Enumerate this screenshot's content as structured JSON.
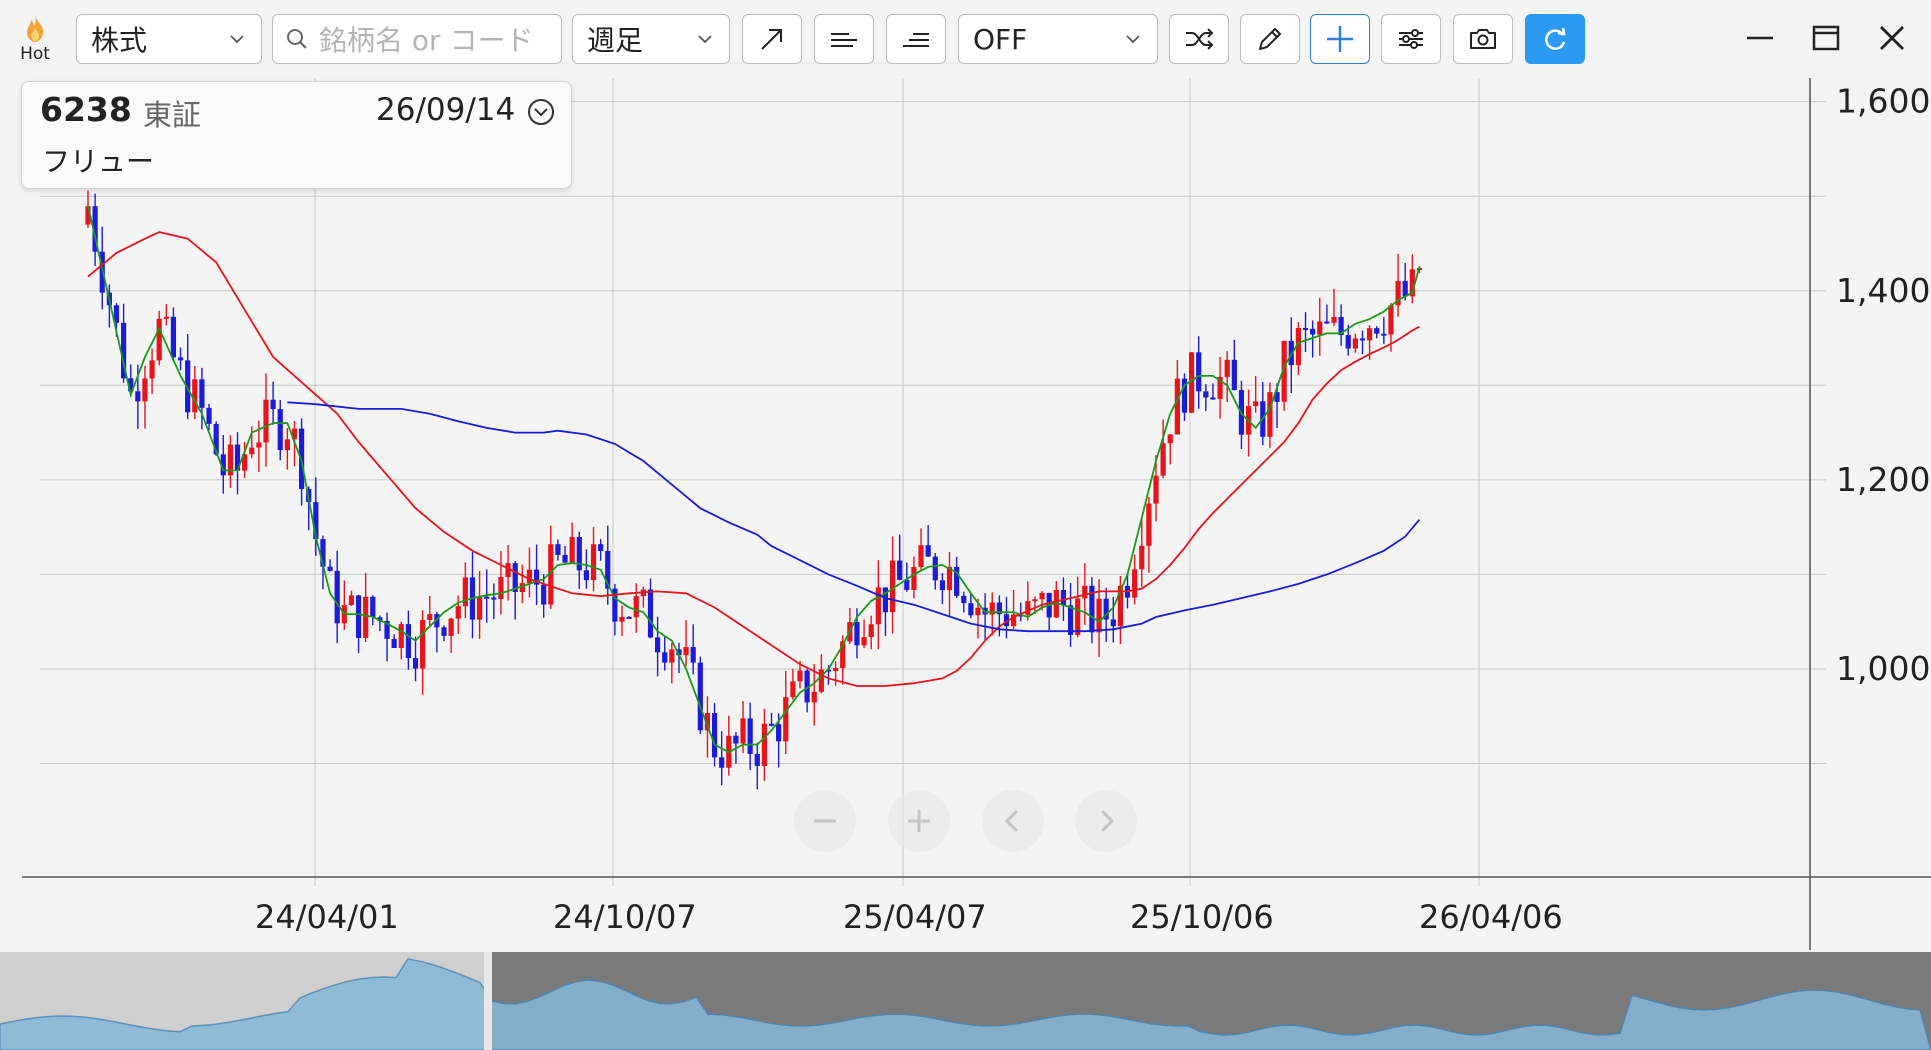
{
  "toolbar": {
    "hot_label": "Hot",
    "market_select": "株式",
    "search_placeholder": "銘柄名 or コード",
    "period_select": "週足",
    "indicator_select": "OFF",
    "icons": [
      "trendline-icon",
      "horizontal-line-icon",
      "horizontal-lines-icon",
      "shuffle-icon",
      "pencil-icon",
      "crosshair-icon",
      "settings-sliders-icon",
      "camera-icon",
      "refresh-icon"
    ]
  },
  "window": {
    "icons": [
      "minimize-icon",
      "maximize-icon",
      "close-icon"
    ]
  },
  "info": {
    "code": "6238",
    "exchange": "東証",
    "date": "26/09/14",
    "name": "フリュー"
  },
  "colors": {
    "up": "#e8141c",
    "down": "#1b1bd8",
    "ma_short": "#1a9a1a",
    "ma_mid": "#e8141c",
    "ma_long": "#1b1bd8",
    "accent": "#2c9af0"
  },
  "chart_data": {
    "type": "candlestick",
    "period": "weekly",
    "y_axis": {
      "ticks": [
        1000,
        1200,
        1400,
        1600
      ],
      "range": [
        780,
        1625
      ],
      "position": "right",
      "grid": true
    },
    "x_axis": {
      "tick_labels": [
        "24/04/01",
        "24/10/07",
        "25/04/07",
        "25/10/06",
        "26/04/06"
      ],
      "grid": true
    },
    "approx_price_range_low_high": [
      810,
      1505
    ],
    "last_close_estimate": 1480,
    "moving_averages": [
      {
        "color": "green",
        "points": [
          [
            0,
            1490
          ],
          [
            3,
            1390
          ],
          [
            6,
            1290
          ],
          [
            8,
            1330
          ],
          [
            10,
            1360
          ],
          [
            13,
            1310
          ],
          [
            16,
            1270
          ],
          [
            19,
            1210
          ],
          [
            21,
            1210
          ],
          [
            23,
            1250
          ],
          [
            26,
            1260
          ],
          [
            28,
            1260
          ],
          [
            30,
            1220
          ],
          [
            32,
            1140
          ],
          [
            34,
            1080
          ],
          [
            36,
            1058
          ],
          [
            38,
            1058
          ],
          [
            40,
            1055
          ],
          [
            42,
            1048
          ],
          [
            44,
            1040
          ],
          [
            46,
            1030
          ],
          [
            48,
            1045
          ],
          [
            50,
            1060
          ],
          [
            52,
            1070
          ],
          [
            54,
            1075
          ],
          [
            56,
            1078
          ],
          [
            58,
            1080
          ],
          [
            60,
            1085
          ],
          [
            62,
            1090
          ],
          [
            64,
            1095
          ],
          [
            66,
            1110
          ],
          [
            68,
            1112
          ],
          [
            70,
            1110
          ],
          [
            72,
            1105
          ],
          [
            74,
            1075
          ],
          [
            76,
            1065
          ],
          [
            78,
            1060
          ],
          [
            80,
            1040
          ],
          [
            82,
            1030
          ],
          [
            84,
            1000
          ],
          [
            86,
            960
          ],
          [
            88,
            920
          ],
          [
            90,
            912
          ],
          [
            92,
            920
          ],
          [
            94,
            920
          ],
          [
            96,
            935
          ],
          [
            98,
            955
          ],
          [
            100,
            975
          ],
          [
            102,
            985
          ],
          [
            104,
            1000
          ],
          [
            106,
            1025
          ],
          [
            108,
            1055
          ],
          [
            110,
            1072
          ],
          [
            112,
            1080
          ],
          [
            114,
            1090
          ],
          [
            116,
            1100
          ],
          [
            118,
            1108
          ],
          [
            120,
            1110
          ],
          [
            122,
            1102
          ],
          [
            124,
            1080
          ],
          [
            126,
            1060
          ],
          [
            128,
            1060
          ],
          [
            130,
            1060
          ],
          [
            132,
            1055
          ],
          [
            134,
            1065
          ],
          [
            136,
            1070
          ],
          [
            138,
            1065
          ],
          [
            140,
            1060
          ],
          [
            142,
            1050
          ],
          [
            144,
            1065
          ],
          [
            146,
            1100
          ],
          [
            148,
            1160
          ],
          [
            150,
            1220
          ],
          [
            152,
            1270
          ],
          [
            154,
            1300
          ],
          [
            156,
            1310
          ],
          [
            158,
            1310
          ],
          [
            160,
            1300
          ],
          [
            162,
            1270
          ],
          [
            164,
            1255
          ],
          [
            166,
            1275
          ],
          [
            168,
            1320
          ],
          [
            170,
            1345
          ],
          [
            172,
            1350
          ],
          [
            174,
            1355
          ],
          [
            176,
            1355
          ],
          [
            178,
            1365
          ],
          [
            180,
            1370
          ],
          [
            182,
            1378
          ],
          [
            184,
            1390
          ],
          [
            186,
            1398
          ],
          [
            187,
            1425
          ]
        ]
      },
      {
        "color": "red",
        "points": [
          [
            0,
            1415
          ],
          [
            4,
            1440
          ],
          [
            8,
            1455
          ],
          [
            10,
            1462
          ],
          [
            14,
            1455
          ],
          [
            18,
            1430
          ],
          [
            22,
            1380
          ],
          [
            26,
            1330
          ],
          [
            29,
            1310
          ],
          [
            32,
            1290
          ],
          [
            35,
            1270
          ],
          [
            38,
            1240
          ],
          [
            42,
            1205
          ],
          [
            46,
            1170
          ],
          [
            50,
            1145
          ],
          [
            54,
            1125
          ],
          [
            58,
            1110
          ],
          [
            62,
            1095
          ],
          [
            66,
            1085
          ],
          [
            68,
            1080
          ],
          [
            72,
            1077
          ],
          [
            76,
            1080
          ],
          [
            80,
            1082
          ],
          [
            84,
            1080
          ],
          [
            88,
            1065
          ],
          [
            92,
            1045
          ],
          [
            96,
            1025
          ],
          [
            100,
            1005
          ],
          [
            104,
            990
          ],
          [
            108,
            982
          ],
          [
            112,
            982
          ],
          [
            116,
            985
          ],
          [
            120,
            990
          ],
          [
            122,
            998
          ],
          [
            124,
            1012
          ],
          [
            126,
            1030
          ],
          [
            128,
            1045
          ],
          [
            130,
            1055
          ],
          [
            134,
            1068
          ],
          [
            138,
            1075
          ],
          [
            142,
            1082
          ],
          [
            146,
            1082
          ],
          [
            148,
            1085
          ],
          [
            150,
            1095
          ],
          [
            152,
            1110
          ],
          [
            154,
            1128
          ],
          [
            156,
            1148
          ],
          [
            158,
            1165
          ],
          [
            160,
            1180
          ],
          [
            162,
            1195
          ],
          [
            164,
            1210
          ],
          [
            166,
            1225
          ],
          [
            168,
            1240
          ],
          [
            170,
            1260
          ],
          [
            172,
            1285
          ],
          [
            174,
            1302
          ],
          [
            176,
            1316
          ],
          [
            178,
            1325
          ],
          [
            180,
            1333
          ],
          [
            182,
            1340
          ],
          [
            184,
            1348
          ],
          [
            186,
            1358
          ],
          [
            187,
            1362
          ]
        ]
      },
      {
        "color": "blue",
        "points": [
          [
            28,
            1282
          ],
          [
            32,
            1280
          ],
          [
            38,
            1275
          ],
          [
            44,
            1275
          ],
          [
            48,
            1270
          ],
          [
            52,
            1262
          ],
          [
            56,
            1255
          ],
          [
            60,
            1250
          ],
          [
            64,
            1250
          ],
          [
            66,
            1252
          ],
          [
            70,
            1248
          ],
          [
            74,
            1238
          ],
          [
            78,
            1220
          ],
          [
            82,
            1195
          ],
          [
            86,
            1170
          ],
          [
            90,
            1155
          ],
          [
            94,
            1142
          ],
          [
            96,
            1130
          ],
          [
            100,
            1115
          ],
          [
            104,
            1100
          ],
          [
            108,
            1088
          ],
          [
            112,
            1075
          ],
          [
            116,
            1068
          ],
          [
            120,
            1058
          ],
          [
            124,
            1048
          ],
          [
            128,
            1042
          ],
          [
            132,
            1040
          ],
          [
            136,
            1040
          ],
          [
            140,
            1040
          ],
          [
            144,
            1042
          ],
          [
            148,
            1048
          ],
          [
            150,
            1055
          ],
          [
            154,
            1062
          ],
          [
            158,
            1068
          ],
          [
            162,
            1075
          ],
          [
            166,
            1082
          ],
          [
            170,
            1090
          ],
          [
            174,
            1100
          ],
          [
            178,
            1112
          ],
          [
            182,
            1125
          ],
          [
            185,
            1140
          ],
          [
            187,
            1158
          ]
        ]
      }
    ],
    "navigator": {
      "window": "full-range",
      "highlight": "2023-2024"
    }
  }
}
